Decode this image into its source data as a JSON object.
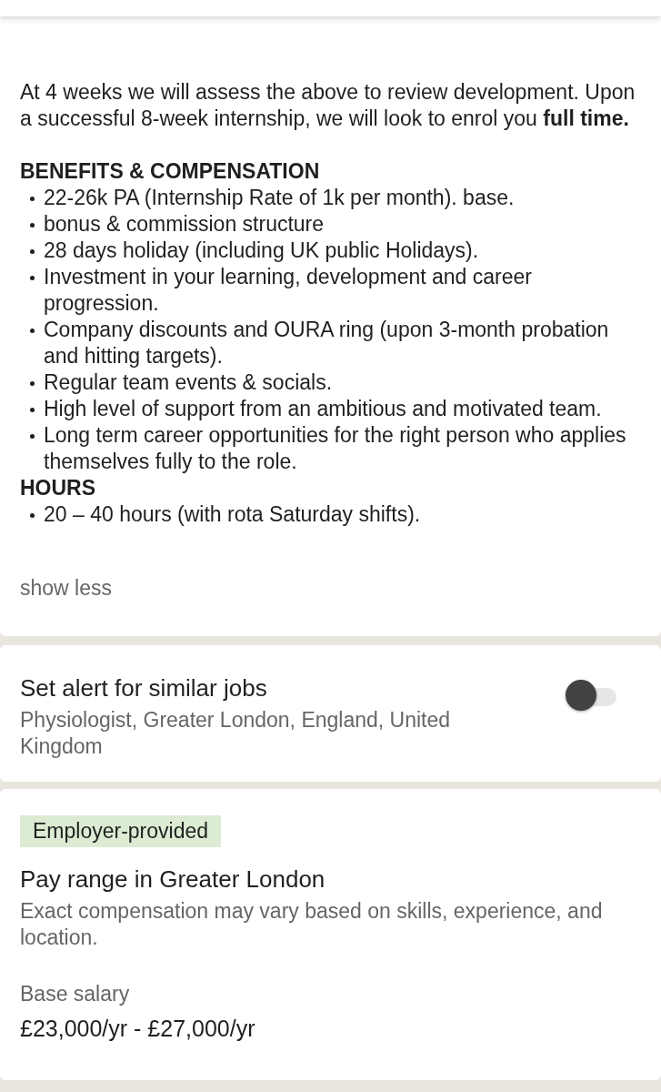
{
  "description": {
    "paragraph": "At 4 weeks we will assess the above to review development. Upon a successful 8-week internship, we will look to enrol you **full time.**",
    "sections": [
      {
        "heading": "BENEFITS & COMPENSATION",
        "items": [
          "22-26k PA (Internship Rate of 1k per month). base.",
          "bonus & commission structure",
          "28 days holiday (including UK public Holidays).",
          "Investment in your learning, development and career progression.",
          "Company discounts and OURA ring (upon 3-month probation and hitting targets).",
          "Regular team events & socials.",
          "High level of support from an ambitious and motivated team.",
          "Long term career opportunities for the right person who applies themselves fully to the role."
        ]
      },
      {
        "heading": "HOURS",
        "items": [
          "20 – 40 hours (with rota Saturday shifts)."
        ]
      }
    ],
    "toggle_link": "show less"
  },
  "job_alert": {
    "title": "Set alert for similar jobs",
    "subtitle": "Physiologist, Greater London, England, United Kingdom",
    "on": false
  },
  "pay": {
    "badge": "Employer-provided",
    "title": "Pay range in Greater London",
    "note": "Exact compensation may vary based on skills, experience, and location.",
    "label": "Base salary",
    "value": "£23,000/yr - £27,000/yr"
  }
}
